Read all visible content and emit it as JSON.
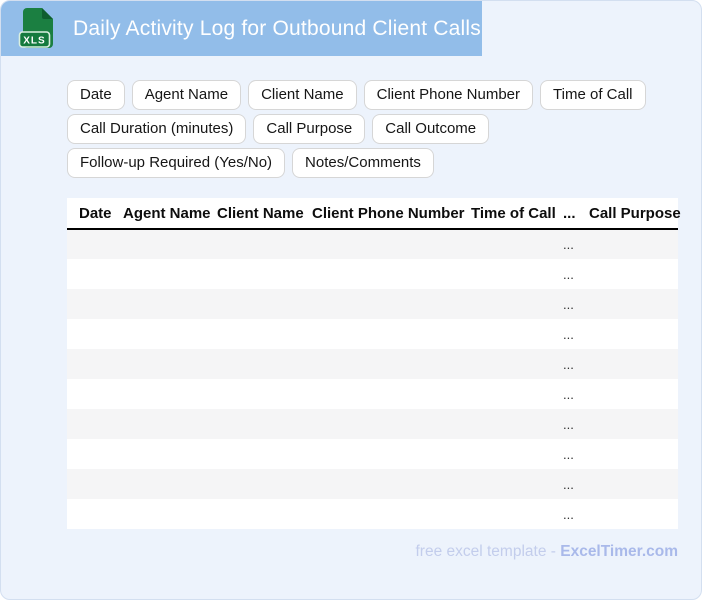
{
  "header": {
    "title": "Daily Activity Log for Outbound Client Calls",
    "icon_label": "XLS",
    "banner_color": "#92bde9"
  },
  "chips": [
    "Date",
    "Agent Name",
    "Client Name",
    "Client Phone Number",
    "Time of Call",
    "Call Duration (minutes)",
    "Call Purpose",
    "Call Outcome",
    "Follow-up Required (Yes/No)",
    "Notes/Comments"
  ],
  "table": {
    "columns": [
      "Date",
      "Agent Name",
      "Client Name",
      "Client Phone Number",
      "Time of Call",
      "...",
      "Call Purpose"
    ],
    "row_count": 10,
    "row_placeholder": "...",
    "placeholder_col_index": 5
  },
  "footer": {
    "prefix": "free excel template - ",
    "brand": "ExcelTimer.com"
  },
  "colors": {
    "banner": "#92bde9",
    "page_background": "#edf3fc",
    "stripe": "#f5f5f6",
    "icon_green": "#1b7f41",
    "icon_green_dark": "#0f5e2e",
    "footer_text": "#c3cdec",
    "footer_brand": "#a9b9ea"
  }
}
